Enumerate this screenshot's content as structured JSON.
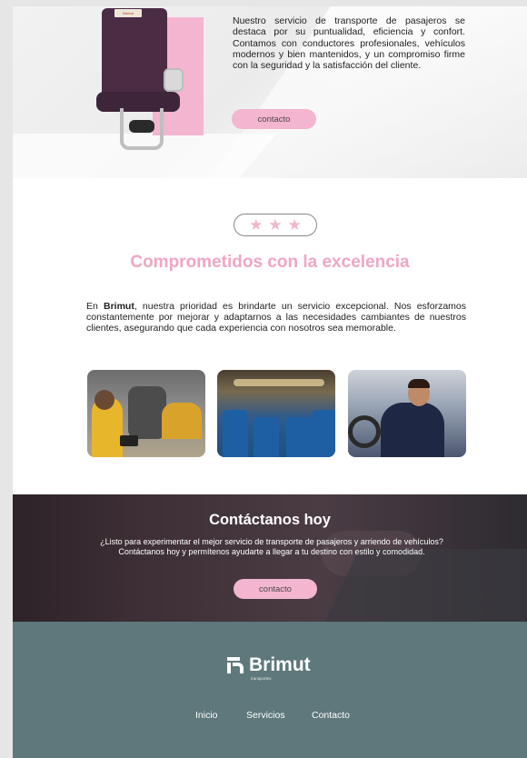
{
  "hero": {
    "seat_tag": "Brimut",
    "text": "Nuestro servicio de transporte de pasajeros se destaca por su puntualidad, eficiencia y confort. Contamos con conductores profesionales, vehículos modernos y bien mantenidos, y un compromiso firme con la seguridad y la satisfacción del cliente.",
    "button_label": "contacto"
  },
  "excellence": {
    "stars": "★ ★ ★",
    "title": "Comprometidos con la excelencia",
    "text_brand": "Brimut",
    "text_before": "En ",
    "text_after": ", nuestra prioridad es brindarte un servicio excepcional. Nos esforzamos constantemente por mejorar y adaptarnos a las necesidades cambiantes de nuestros clientes, asegurando que cada experiencia con nosotros sea memorable."
  },
  "contact": {
    "title": "Contáctanos hoy",
    "text": "¿Listo para experimentar el mejor servicio de transporte de pasajeros y arriendo de vehículos? Contáctanos hoy y permítenos ayudarte a llegar a tu destino con estilo y comodidad.",
    "button_label": "contacto"
  },
  "footer": {
    "logo_name": "Brimut",
    "logo_sub": "transportes",
    "nav": [
      "Inicio",
      "Servicios",
      "Contacto"
    ]
  },
  "colors": {
    "accent_pink": "#f3b5cf",
    "title_pink": "#efa6c3",
    "footer_teal": "#5f787b"
  }
}
